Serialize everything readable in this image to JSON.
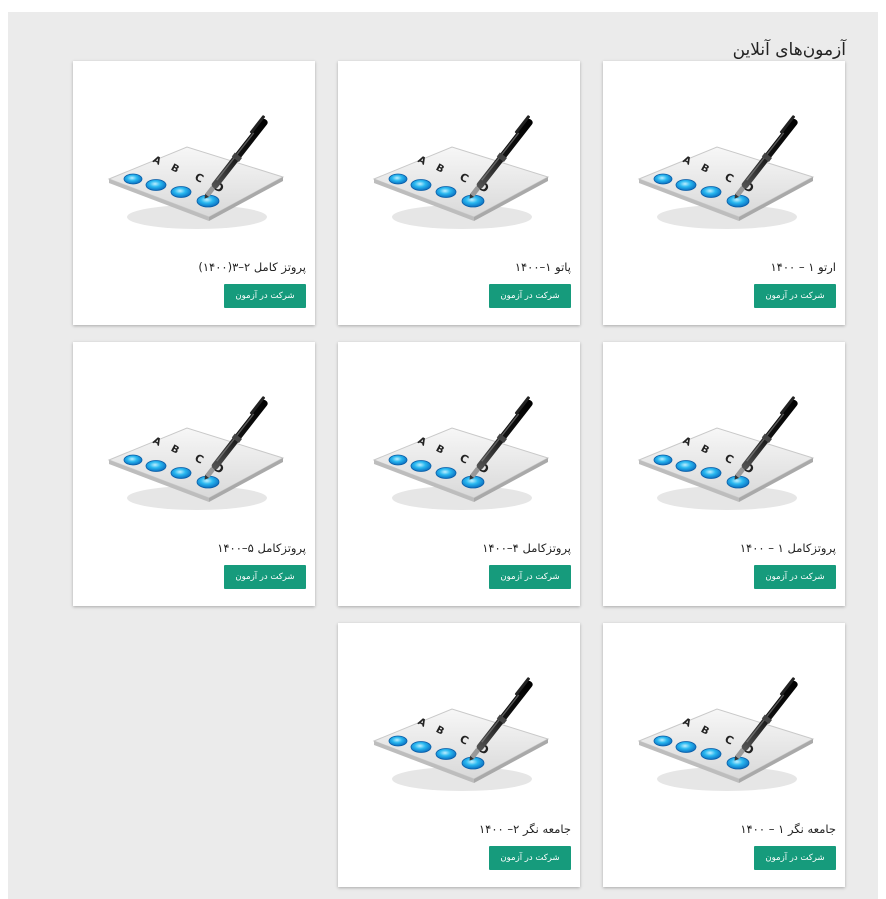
{
  "page": {
    "title": "آزمون‌های آنلاین"
  },
  "theme": {
    "panel_bg": "#ebebeb",
    "button_bg": "#169b7c",
    "button_text": "#ffffff",
    "card_bg": "#ffffff",
    "bubble": "#19a6e8",
    "icon": "test-sheet-with-pen-icon"
  },
  "exams": [
    {
      "title": "ارتو ۱ – ۱۴۰۰",
      "button": "شرکت در آزمون"
    },
    {
      "title": "پاتو ۱–۱۴۰۰",
      "button": "شرکت در آزمون"
    },
    {
      "title": "پروتز کامل ۲–۳(۱۴۰۰)",
      "button": "شرکت در آزمون"
    },
    {
      "title": "پروتزکامل ۱ – ۱۴۰۰",
      "button": "شرکت در آزمون"
    },
    {
      "title": "پروتزکامل ۴–۱۴۰۰",
      "button": "شرکت در آزمون"
    },
    {
      "title": "پروتزکامل ۵–۱۴۰۰",
      "button": "شرکت در آزمون"
    },
    {
      "title": "جامعه نگر ۱ – ۱۴۰۰",
      "button": "شرکت در آزمون"
    },
    {
      "title": "جامعه نگر ۲– ۱۴۰۰",
      "button": "شرکت در آزمون"
    }
  ]
}
